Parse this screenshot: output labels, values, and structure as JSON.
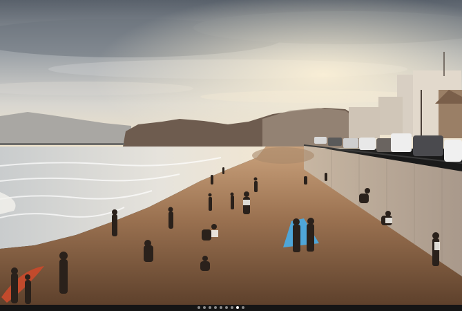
{
  "photo": {
    "subject": "beach-at-sunset",
    "colors": {
      "sky_top": "#5f6770",
      "sky_mid": "#b9bcc0",
      "horizon_glow": "#f3e6cf",
      "sea": "#d9dcdc",
      "sand_light": "#c9a583",
      "sand_dark": "#6a4a33",
      "wall": "#b9a898",
      "hill": "#5b4a40"
    }
  },
  "carousel": {
    "total": 9,
    "active_index": 7
  }
}
